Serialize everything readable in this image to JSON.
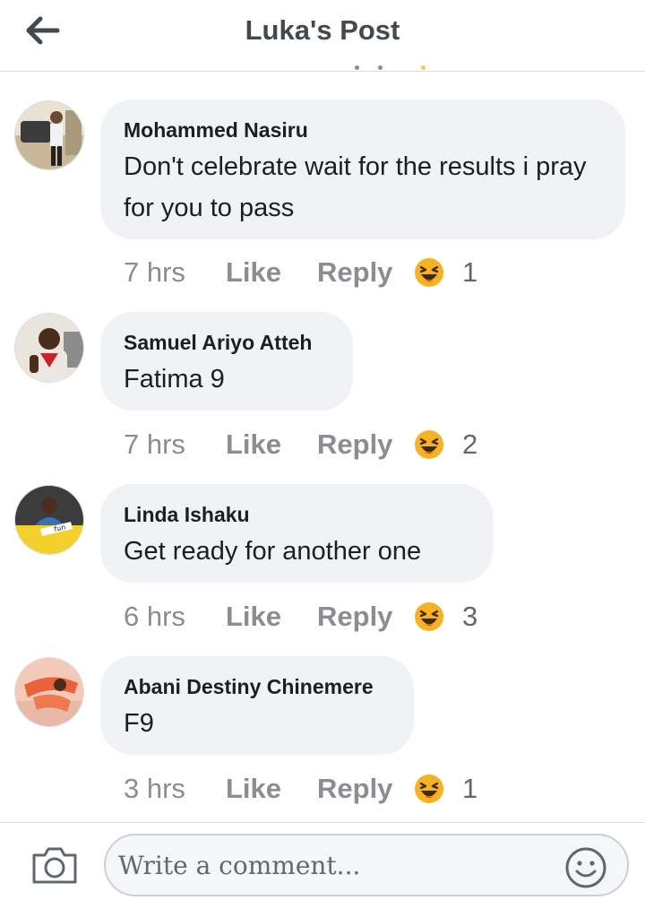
{
  "header": {
    "title": "Luka's Post",
    "back_icon": "arrow-left-icon"
  },
  "comments": [
    {
      "author": "Mohammed Nasiru",
      "text": "Don't celebrate wait for the results i pray for you to pass",
      "time": "7 hrs",
      "like_label": "Like",
      "reply_label": "Reply",
      "reaction_icon": "laughing-face-icon",
      "reaction_count": "1"
    },
    {
      "author": "Samuel Ariyo Atteh",
      "text": "Fatima 9",
      "time": "7 hrs",
      "like_label": "Like",
      "reply_label": "Reply",
      "reaction_icon": "laughing-face-icon",
      "reaction_count": "2"
    },
    {
      "author": "Linda Ishaku",
      "text": "Get ready for another one",
      "time": "6 hrs",
      "like_label": "Like",
      "reply_label": "Reply",
      "reaction_icon": "laughing-face-icon",
      "reaction_count": "3"
    },
    {
      "author": "Abani Destiny Chinemere",
      "text": "F9",
      "time": "3 hrs",
      "like_label": "Like",
      "reply_label": "Reply",
      "reaction_icon": "laughing-face-icon",
      "reaction_count": "1"
    }
  ],
  "composer": {
    "placeholder": "Write a comment...",
    "camera_icon": "camera-icon",
    "emoji_icon": "smiley-icon"
  },
  "colors": {
    "bubble_bg": "#f0f2f5",
    "meta_text": "#8a8d91",
    "reaction_yellow": "#f7b125"
  }
}
